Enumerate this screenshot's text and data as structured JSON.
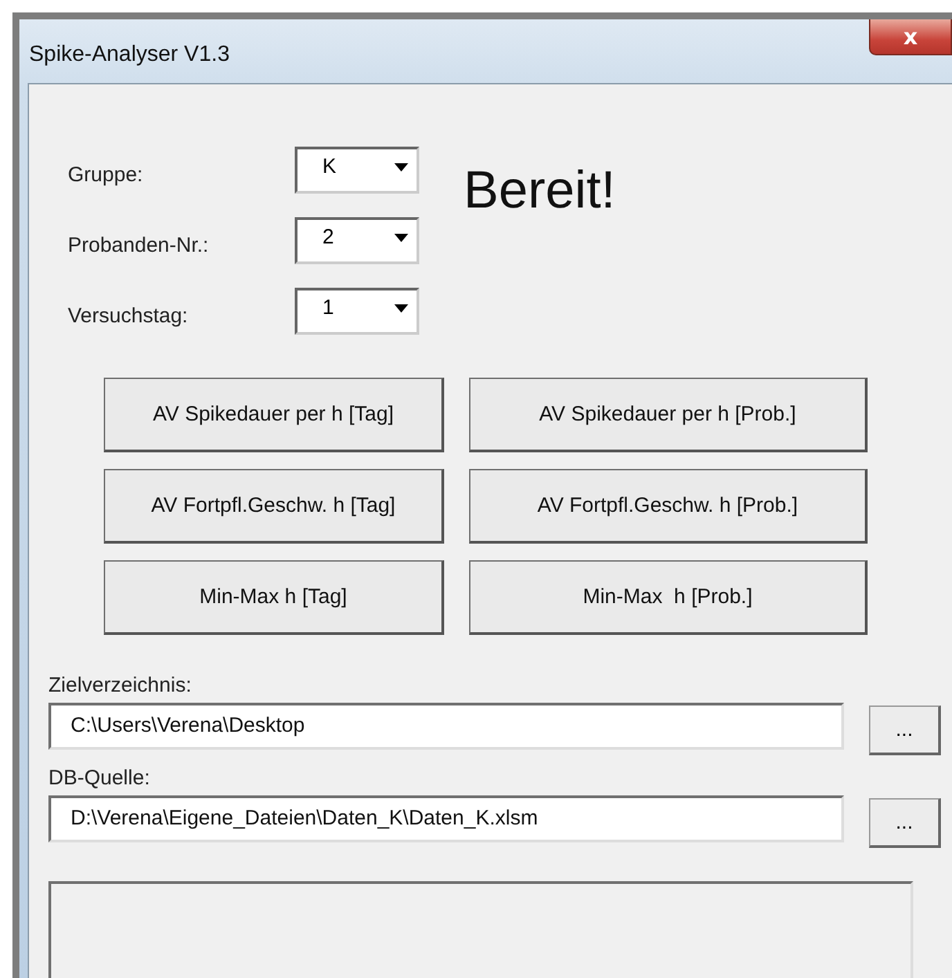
{
  "window": {
    "title": "Spike-Analyser V1.3",
    "close": "x"
  },
  "selectors": [
    {
      "label": "Gruppe:",
      "value": "K"
    },
    {
      "label": "Probanden-Nr.:",
      "value": "2"
    },
    {
      "label": "Versuchstag:",
      "value": "1"
    }
  ],
  "status_text": "Bereit!",
  "buttons": [
    [
      "AV Spikedauer per h [Tag]",
      "AV Spikedauer per h [Prob.]"
    ],
    [
      "AV Fortpfl.Geschw. h [Tag]",
      "AV Fortpfl.Geschw. h [Prob.]"
    ],
    [
      "Min-Max h [Tag]",
      "Min-Max  h [Prob.]"
    ]
  ],
  "paths": [
    {
      "label": "Zielverzeichnis:",
      "value": "C:\\Users\\Verena\\Desktop",
      "browse": "..."
    },
    {
      "label": "DB-Quelle:",
      "value": "D:\\Verena\\Eigene_Dateien\\Daten_K\\Daten_K.xlsm",
      "browse": "..."
    }
  ]
}
